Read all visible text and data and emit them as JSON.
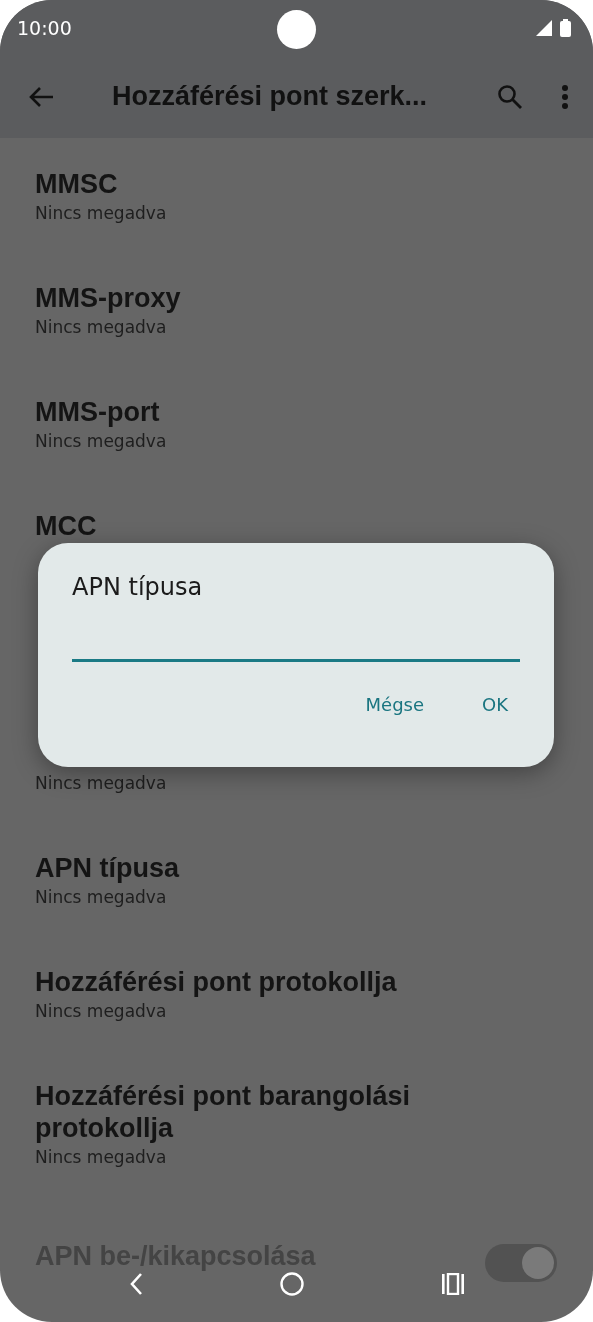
{
  "status_bar": {
    "time": "10:00"
  },
  "app_bar": {
    "title": "Hozzáférési pont szerk..."
  },
  "items": [
    {
      "kind": "text",
      "title": "MMSC",
      "subtitle": "Nincs megadva"
    },
    {
      "kind": "text",
      "title": "MMS-proxy",
      "subtitle": "Nincs megadva"
    },
    {
      "kind": "text",
      "title": "MMS-port",
      "subtitle": "Nincs megadva"
    },
    {
      "kind": "text",
      "title": "MCC"
    },
    {
      "kind": "covered"
    },
    {
      "kind": "text",
      "subtitle": "Nincs megadva"
    },
    {
      "kind": "text",
      "title": "APN típusa",
      "subtitle": "Nincs megadva"
    },
    {
      "kind": "text",
      "title": "Hozzáférési pont protokollja",
      "subtitle": "Nincs megadva"
    },
    {
      "kind": "text",
      "title": "Hozzáférési pont barangolási protokollja",
      "subtitle": "Nincs megadva"
    },
    {
      "kind": "switch",
      "title": "APN be-/kikapcsolása",
      "on": true
    }
  ],
  "dialog": {
    "title": "APN típusa",
    "buttons": [
      "Mégse",
      "OK"
    ]
  }
}
